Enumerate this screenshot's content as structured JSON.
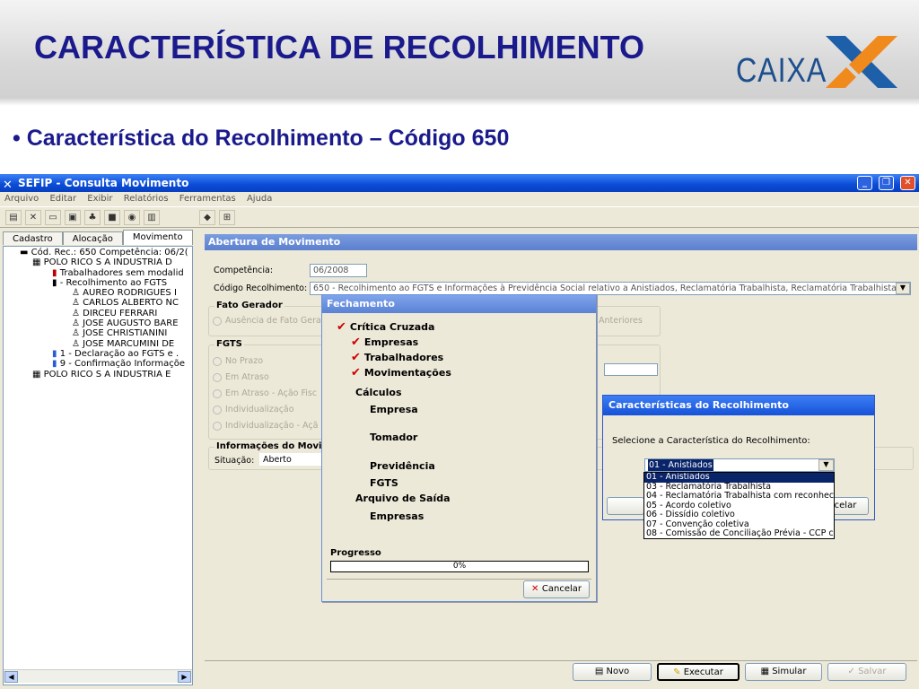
{
  "slide": {
    "title": "CARACTERÍSTICA DE RECOLHIMENTO",
    "logo_text": "CAIXA",
    "bullet_text": "• Característica do Recolhimento – Código 650"
  },
  "window": {
    "title": "SEFIP - Consulta Movimento",
    "menu": [
      "Arquivo",
      "Editar",
      "Exibir",
      "Relatórios",
      "Ferramentas",
      "Ajuda"
    ]
  },
  "tabs": [
    "Cadastro",
    "Alocação",
    "Movimento"
  ],
  "tree": [
    "Cód. Rec.: 650 Competência: 06/2(",
    "POLO RICO S A INDUSTRIA D",
    "Trabalhadores sem modalid",
    "- Recolhimento ao FGTS",
    "AUREO RODRIGUES I",
    "CARLOS ALBERTO NC",
    "DIRCEU FERRARI",
    "JOSE AUGUSTO BARE",
    "JOSE CHRISTIANINI",
    "JOSE MARCUMINI DE",
    "1 - Declaração ao FGTS e .",
    "9 - Confirmação Informaçõe",
    "POLO RICO S A INDUSTRIA E"
  ],
  "main": {
    "header": "Abertura de Movimento",
    "competencia_label": "Competência:",
    "competencia_value": "06/2008",
    "codigo_label": "Código Recolhimento:",
    "codigo_value": "650 - Recolhimento ao FGTS e Informações à Previdência Social relativo a Anistiados, Reclamatória Trabalhista, Reclamatória Trabalhista",
    "fato_group": "Fato Gerador",
    "fato_radio": "Ausência de Fato Gera",
    "anteriores": "Anteriores",
    "fgts_group": "FGTS",
    "fgts_radios": [
      "No Prazo",
      "Em Atraso",
      "Em Atraso - Ação Fisc",
      "Individualização",
      "Individualização - Açã"
    ],
    "info_group": "Informações do Movi",
    "situacao_label": "Situação:",
    "situacao_value": "Aberto"
  },
  "bottom_buttons": {
    "novo": "Novo",
    "executar": "Executar",
    "simular": "Simular",
    "salvar": "Salvar"
  },
  "fechamento": {
    "title": "Fechamento",
    "critica": "Crítica Cruzada",
    "empresas": "Empresas",
    "trabalhadores": "Trabalhadores",
    "movimentacoes": "Movimentações",
    "calculos": "Cálculos",
    "empresa": "Empresa",
    "tomador": "Tomador",
    "previdencia": "Previdência",
    "fgts": "FGTS",
    "arquivo_saida": "Arquivo de Saída",
    "empresas2": "Empresas",
    "progresso": "Progresso",
    "percent": "0%",
    "progress_fraction": 0,
    "cancelar": "Cancelar"
  },
  "caract": {
    "title": "Características do Recolhimento",
    "prompt": "Selecione a Característica do Recolhimento:",
    "selected": "01 - Anistiados",
    "cancel_partial": "celar",
    "options": [
      "01 - Anistiados",
      "03 - Reclamatória Trabalhista",
      "04 - Reclamatória Trabalhista com reconhec",
      "05 - Acordo coletivo",
      "06 - Dissídio coletivo",
      "07 - Convenção coletiva",
      "08 - Comissão de Conciliação Prévia - CCP c"
    ]
  }
}
